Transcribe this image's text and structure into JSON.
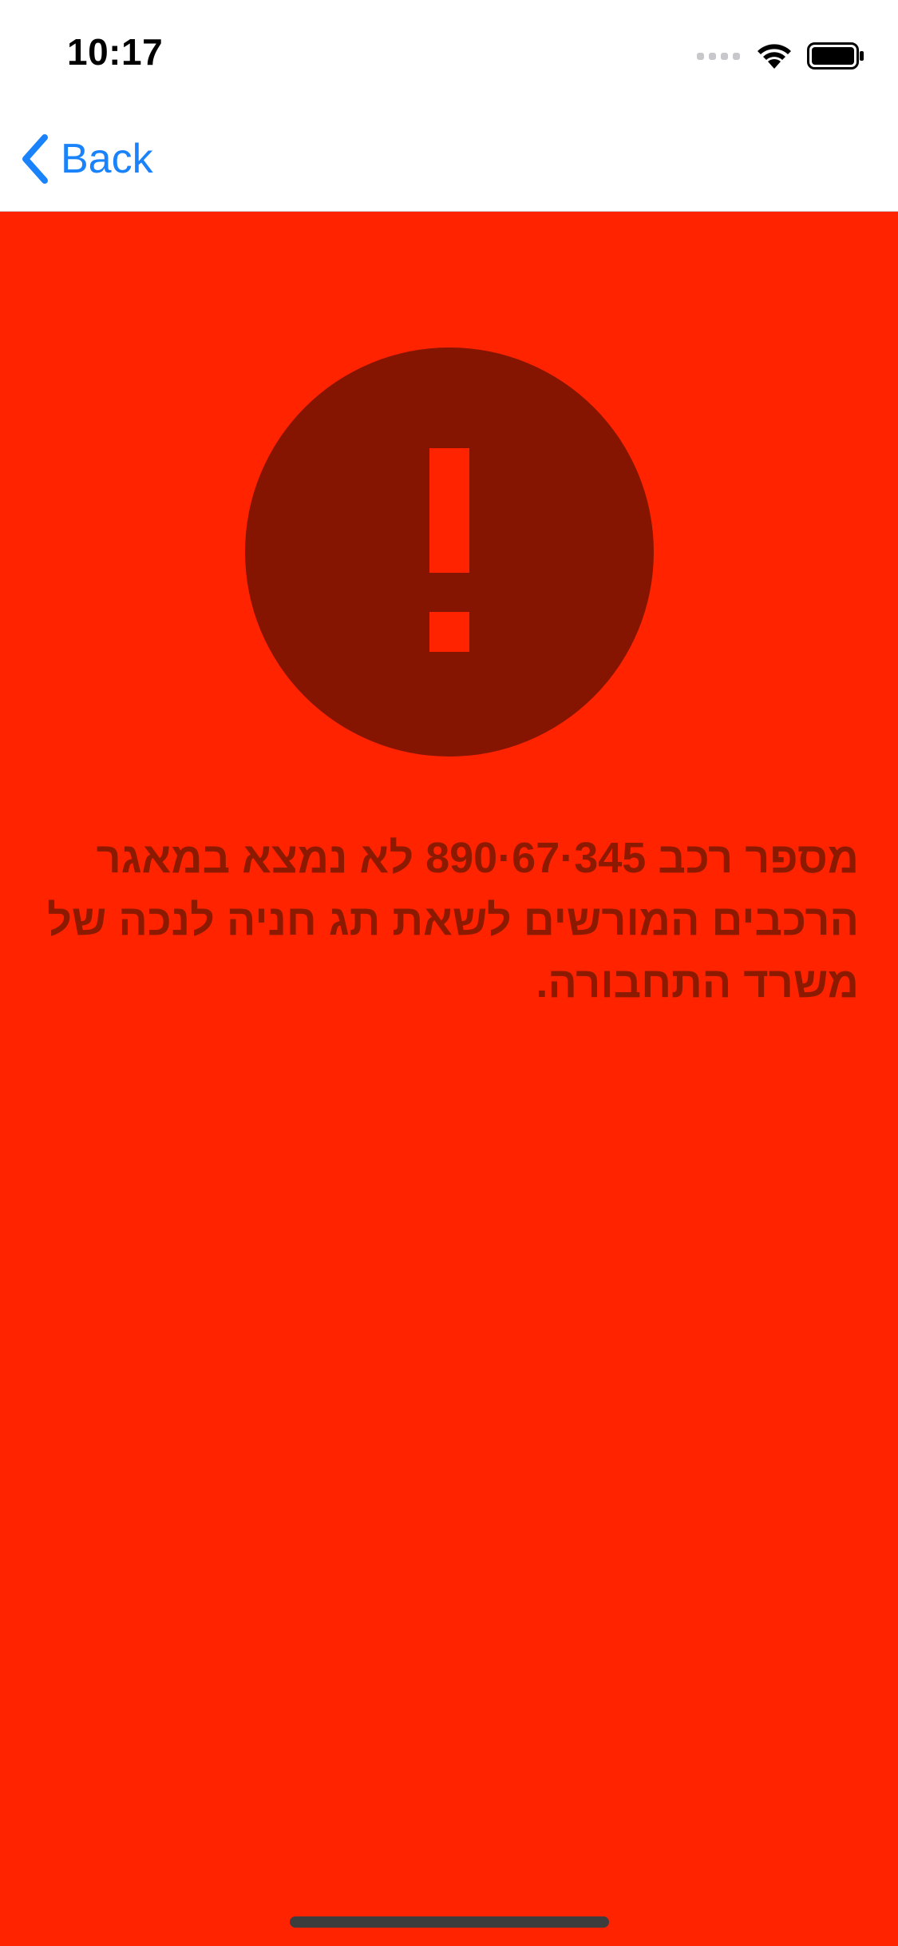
{
  "status_bar": {
    "time": "10:17",
    "icons": [
      "signal-icon",
      "wifi-icon",
      "battery-icon"
    ]
  },
  "nav": {
    "back_label": "Back",
    "back_icon": "chevron-left-icon",
    "accent_color": "#1a82fb"
  },
  "alert": {
    "icon": "exclamation-circle-icon",
    "background_color": "#ff2300",
    "icon_color": "#851500",
    "message": "מספר רכב 345·67·890 לא נמצא במאגר הרכבים המורשים לשאת תג חניה לנכה של משרד התחבורה."
  }
}
